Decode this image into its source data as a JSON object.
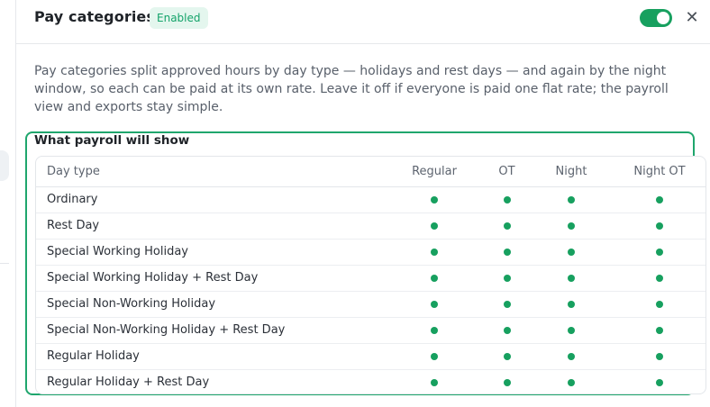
{
  "header": {
    "title": "Pay categories",
    "badge": "Enabled",
    "toggle_on": true,
    "close_label": "✕"
  },
  "description": "Pay categories split approved hours by day type — holidays and rest days — and again by the night window, so each can be paid at its own rate. Leave it off if everyone is paid one flat rate; the payroll view and exports stay simple.",
  "preview": {
    "title": "What payroll will show",
    "columns": [
      "Day type",
      "Regular",
      "OT",
      "Night",
      "Night OT"
    ],
    "rows": [
      "Ordinary",
      "Rest Day",
      "Special Working Holiday",
      "Special Working Holiday + Rest Day",
      "Special Non-Working Holiday",
      "Special Non-Working Holiday + Rest Day",
      "Regular Holiday",
      "Regular Holiday + Rest Day"
    ]
  },
  "colors": {
    "accent": "#17a05f",
    "badge_bg": "#e4f6ee",
    "badge_text": "#14a36a",
    "section_border": "#1fa66d"
  }
}
